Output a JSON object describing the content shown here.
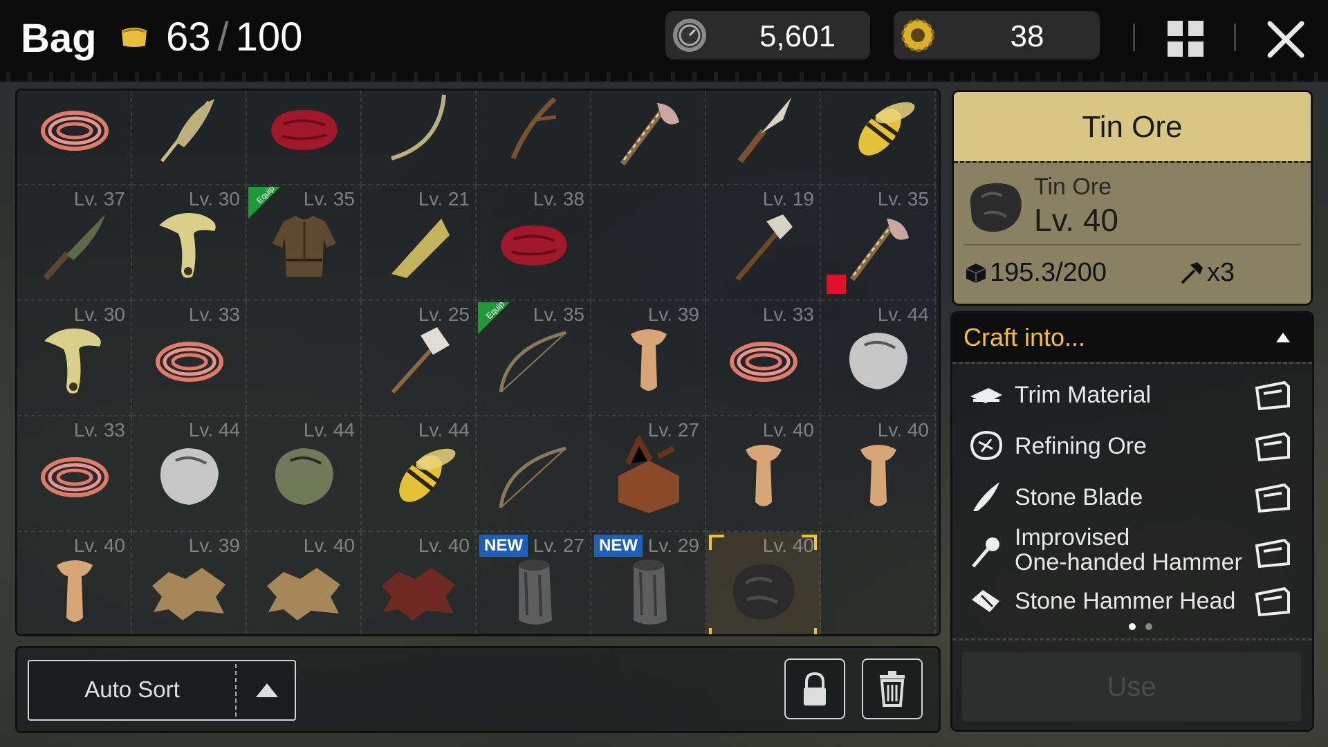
{
  "header": {
    "title": "Bag",
    "capacity_current": "63",
    "capacity_sep": "/",
    "capacity_max": "100",
    "currency_1": "5,601",
    "currency_2": "38"
  },
  "inventory": [
    {
      "lv": "",
      "icon": "rope-icon"
    },
    {
      "lv": "",
      "icon": "feather-icon"
    },
    {
      "lv": "",
      "icon": "raw-meat-icon"
    },
    {
      "lv": "",
      "icon": "bow-string-icon"
    },
    {
      "lv": "",
      "icon": "branch-icon"
    },
    {
      "lv": "",
      "icon": "stone-axe-icon"
    },
    {
      "lv": "",
      "icon": "knife-icon"
    },
    {
      "lv": "",
      "icon": "wasp-icon"
    },
    {
      "lv": "Lv. 37",
      "icon": "stone-knife-icon"
    },
    {
      "lv": "Lv. 30",
      "icon": "mushroom-icon"
    },
    {
      "lv": "Lv. 35",
      "icon": "leather-tunic-icon",
      "equip": "Equip"
    },
    {
      "lv": "Lv. 21",
      "icon": "plank-icon"
    },
    {
      "lv": "Lv. 38",
      "icon": "raw-meat-icon"
    },
    {
      "lv": "",
      "icon": ""
    },
    {
      "lv": "Lv. 19",
      "icon": "stone-hammer-icon"
    },
    {
      "lv": "Lv. 35",
      "icon": "stone-axe-icon",
      "broken": true
    },
    {
      "lv": "Lv. 30",
      "icon": "mushroom-icon"
    },
    {
      "lv": "Lv. 33",
      "icon": "rope-icon"
    },
    {
      "lv": "",
      "icon": ""
    },
    {
      "lv": "Lv. 25",
      "icon": "hammer-icon"
    },
    {
      "lv": "Lv. 35",
      "icon": "bow-icon",
      "equip": "Equip"
    },
    {
      "lv": "Lv. 39",
      "icon": "bone-icon"
    },
    {
      "lv": "Lv. 33",
      "icon": "rope-icon"
    },
    {
      "lv": "Lv. 44",
      "icon": "stone-icon"
    },
    {
      "lv": "Lv. 33",
      "icon": "rope-icon"
    },
    {
      "lv": "Lv. 44",
      "icon": "stone-icon"
    },
    {
      "lv": "Lv. 44",
      "icon": "green-stone-icon"
    },
    {
      "lv": "Lv. 44",
      "icon": "wasp-icon"
    },
    {
      "lv": "",
      "icon": "bow-icon"
    },
    {
      "lv": "Lv. 27",
      "icon": "wood-box-icon"
    },
    {
      "lv": "Lv. 40",
      "icon": "bone-icon"
    },
    {
      "lv": "Lv. 40",
      "icon": "bone-icon"
    },
    {
      "lv": "Lv. 40",
      "icon": "bone-icon"
    },
    {
      "lv": "Lv. 39",
      "icon": "leather-hide-icon"
    },
    {
      "lv": "Lv. 40",
      "icon": "leather-hide-icon"
    },
    {
      "lv": "Lv. 40",
      "icon": "red-hide-icon"
    },
    {
      "lv": "Lv. 27",
      "icon": "log-icon",
      "new": "NEW"
    },
    {
      "lv": "Lv. 29",
      "icon": "log-icon",
      "new": "NEW"
    },
    {
      "lv": "Lv. 40",
      "icon": "tin-ore-icon",
      "selected": true
    },
    {
      "lv": "",
      "icon": ""
    }
  ],
  "bottom": {
    "auto_sort": "Auto Sort"
  },
  "detail": {
    "title": "Tin Ore",
    "name": "Tin Ore",
    "level": "Lv. 40",
    "weight": "195.3/200",
    "count": "x3"
  },
  "craft": {
    "title": "Craft into...",
    "recipes": [
      {
        "label": "Trim Material",
        "icon": "trim-material-icon"
      },
      {
        "label": "Refining Ore",
        "icon": "refining-ore-icon"
      },
      {
        "label": "Stone Blade",
        "icon": "stone-blade-icon"
      },
      {
        "label_1": "Improvised",
        "label_2": "One-handed Hammer",
        "icon": "improvised-hammer-icon"
      },
      {
        "label": "Stone Hammer Head",
        "icon": "hammer-head-icon"
      }
    ],
    "use_label": "Use"
  },
  "colors": {
    "accent": "#f2c230",
    "detail_header": "#d8c685",
    "new_badge": "#1e5fb8",
    "equip_badge": "#1f9a3a"
  }
}
